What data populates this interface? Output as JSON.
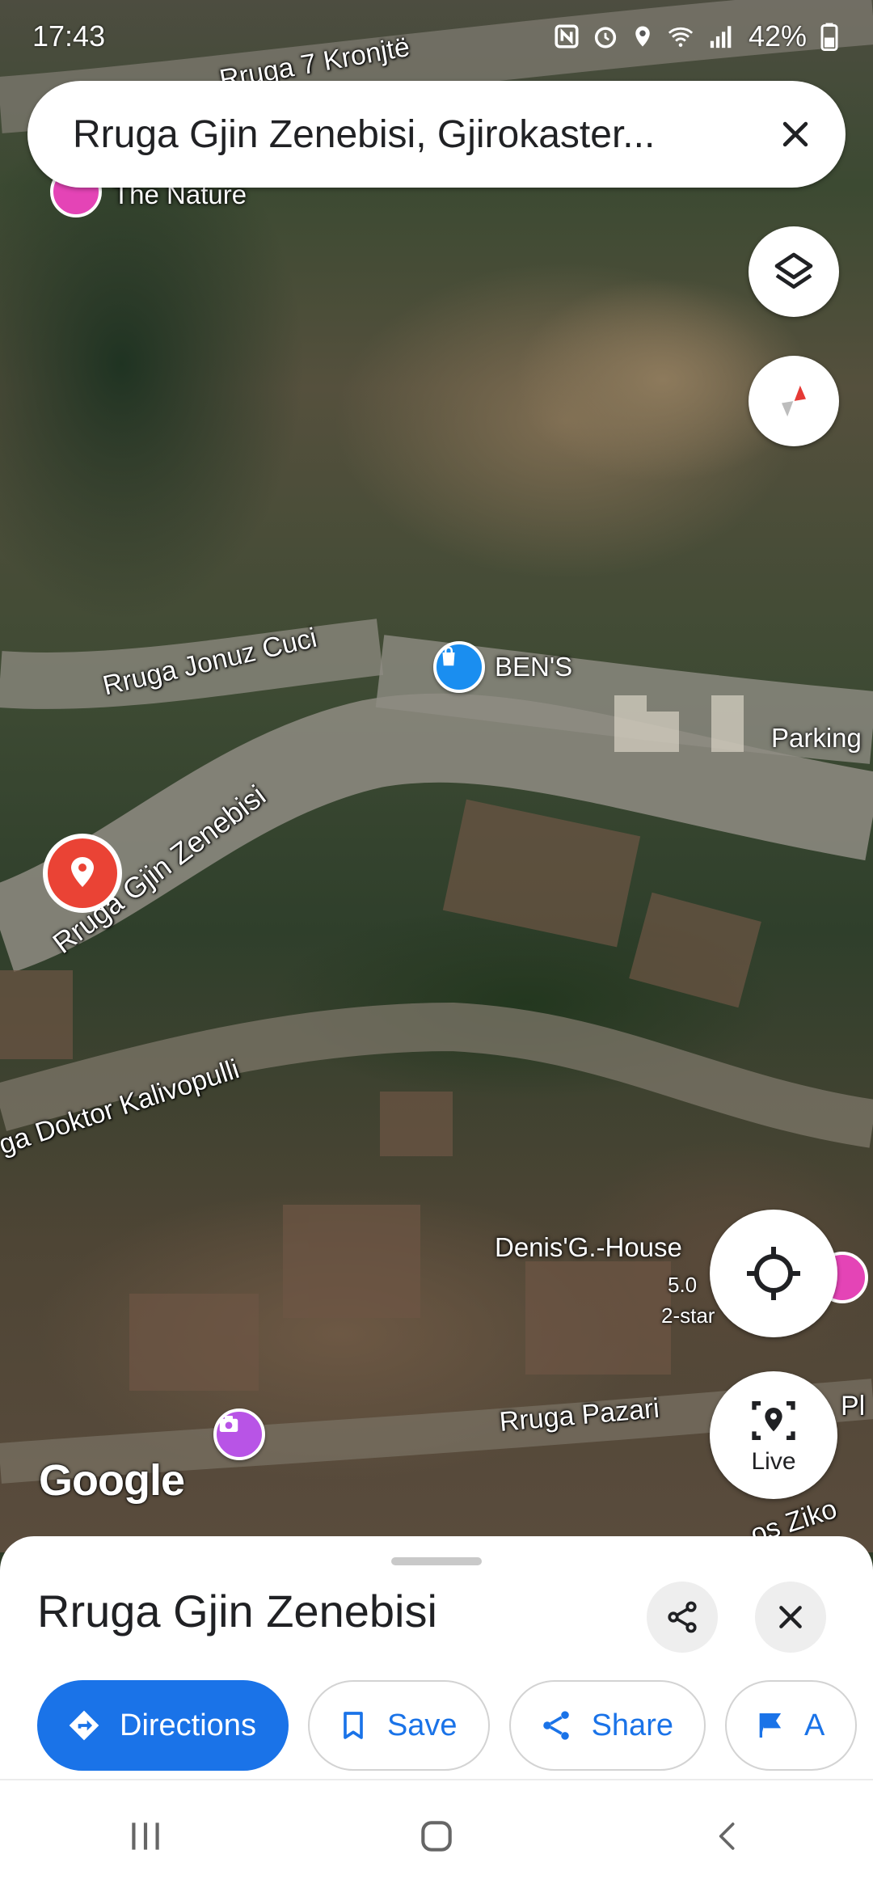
{
  "status_bar": {
    "time": "17:43",
    "battery": "42%",
    "icons": [
      "nfc-icon",
      "alarm-icon",
      "location-icon",
      "wifi-icon",
      "signal-icon",
      "battery-icon"
    ]
  },
  "search": {
    "query": "Rruga Gjin Zenebisi, Gjirokaster...",
    "close_icon": "close-icon"
  },
  "map": {
    "road_labels": {
      "kronjte": "Rruga 7 Kronjtë",
      "jonuz": "Rruga Jonuz Cuci",
      "gjin": "Rruga Gjin Zenebisi",
      "kalivopulli": "ga Doktor Kalivopulli",
      "pazari": "Rruga Pazari",
      "ziko": "os Ziko",
      "pl": "Pl"
    },
    "pois": {
      "nature": "The Nature",
      "bens": "BEN'S",
      "parking": "Parking",
      "denis": "Denis'G.-House",
      "denis_rating": "5.0",
      "denis_class": "2-star"
    },
    "attribution": "Google",
    "controls": {
      "layers_icon": "layers-icon",
      "compass_icon": "compass-icon",
      "my_location_icon": "my-location-icon",
      "live_label": "Live"
    },
    "colors": {
      "selected_pin": "#ea4335",
      "shop_pin": "#1a8ef0",
      "attraction_pin": "#b854e6"
    }
  },
  "sheet": {
    "title": "Rruga Gjin Zenebisi",
    "actions": {
      "directions": "Directions",
      "save": "Save",
      "share": "Share",
      "more": "A"
    },
    "accent": "#1a73e8"
  },
  "nav_bar": {
    "icons": [
      "recents-icon",
      "home-icon",
      "back-icon"
    ]
  }
}
